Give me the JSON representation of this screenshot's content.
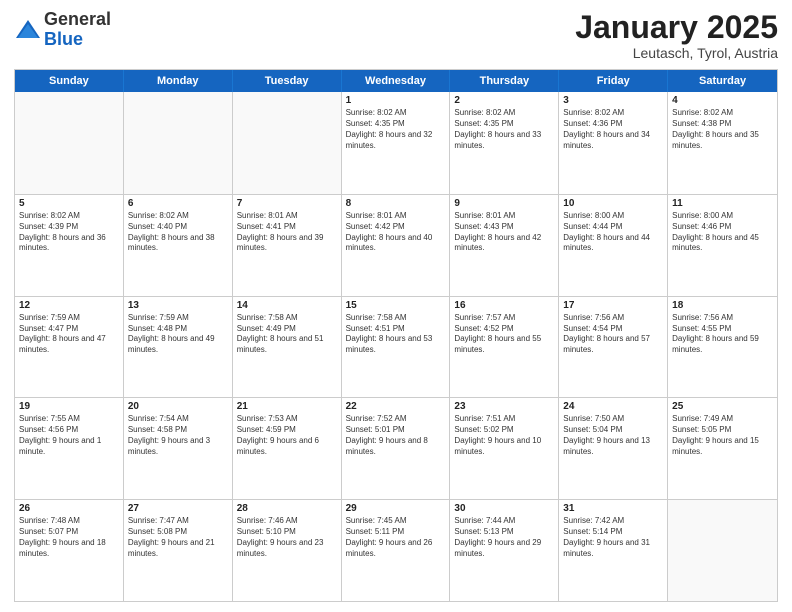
{
  "header": {
    "logo": {
      "general": "General",
      "blue": "Blue"
    },
    "title": "January 2025",
    "location": "Leutasch, Tyrol, Austria"
  },
  "days_of_week": [
    "Sunday",
    "Monday",
    "Tuesday",
    "Wednesday",
    "Thursday",
    "Friday",
    "Saturday"
  ],
  "weeks": [
    [
      {
        "day": "",
        "text": "",
        "empty": true
      },
      {
        "day": "",
        "text": "",
        "empty": true
      },
      {
        "day": "",
        "text": "",
        "empty": true
      },
      {
        "day": "1",
        "text": "Sunrise: 8:02 AM\nSunset: 4:35 PM\nDaylight: 8 hours and 32 minutes."
      },
      {
        "day": "2",
        "text": "Sunrise: 8:02 AM\nSunset: 4:35 PM\nDaylight: 8 hours and 33 minutes."
      },
      {
        "day": "3",
        "text": "Sunrise: 8:02 AM\nSunset: 4:36 PM\nDaylight: 8 hours and 34 minutes."
      },
      {
        "day": "4",
        "text": "Sunrise: 8:02 AM\nSunset: 4:38 PM\nDaylight: 8 hours and 35 minutes."
      }
    ],
    [
      {
        "day": "5",
        "text": "Sunrise: 8:02 AM\nSunset: 4:39 PM\nDaylight: 8 hours and 36 minutes."
      },
      {
        "day": "6",
        "text": "Sunrise: 8:02 AM\nSunset: 4:40 PM\nDaylight: 8 hours and 38 minutes."
      },
      {
        "day": "7",
        "text": "Sunrise: 8:01 AM\nSunset: 4:41 PM\nDaylight: 8 hours and 39 minutes."
      },
      {
        "day": "8",
        "text": "Sunrise: 8:01 AM\nSunset: 4:42 PM\nDaylight: 8 hours and 40 minutes."
      },
      {
        "day": "9",
        "text": "Sunrise: 8:01 AM\nSunset: 4:43 PM\nDaylight: 8 hours and 42 minutes."
      },
      {
        "day": "10",
        "text": "Sunrise: 8:00 AM\nSunset: 4:44 PM\nDaylight: 8 hours and 44 minutes."
      },
      {
        "day": "11",
        "text": "Sunrise: 8:00 AM\nSunset: 4:46 PM\nDaylight: 8 hours and 45 minutes."
      }
    ],
    [
      {
        "day": "12",
        "text": "Sunrise: 7:59 AM\nSunset: 4:47 PM\nDaylight: 8 hours and 47 minutes."
      },
      {
        "day": "13",
        "text": "Sunrise: 7:59 AM\nSunset: 4:48 PM\nDaylight: 8 hours and 49 minutes."
      },
      {
        "day": "14",
        "text": "Sunrise: 7:58 AM\nSunset: 4:49 PM\nDaylight: 8 hours and 51 minutes."
      },
      {
        "day": "15",
        "text": "Sunrise: 7:58 AM\nSunset: 4:51 PM\nDaylight: 8 hours and 53 minutes."
      },
      {
        "day": "16",
        "text": "Sunrise: 7:57 AM\nSunset: 4:52 PM\nDaylight: 8 hours and 55 minutes."
      },
      {
        "day": "17",
        "text": "Sunrise: 7:56 AM\nSunset: 4:54 PM\nDaylight: 8 hours and 57 minutes."
      },
      {
        "day": "18",
        "text": "Sunrise: 7:56 AM\nSunset: 4:55 PM\nDaylight: 8 hours and 59 minutes."
      }
    ],
    [
      {
        "day": "19",
        "text": "Sunrise: 7:55 AM\nSunset: 4:56 PM\nDaylight: 9 hours and 1 minute."
      },
      {
        "day": "20",
        "text": "Sunrise: 7:54 AM\nSunset: 4:58 PM\nDaylight: 9 hours and 3 minutes."
      },
      {
        "day": "21",
        "text": "Sunrise: 7:53 AM\nSunset: 4:59 PM\nDaylight: 9 hours and 6 minutes."
      },
      {
        "day": "22",
        "text": "Sunrise: 7:52 AM\nSunset: 5:01 PM\nDaylight: 9 hours and 8 minutes."
      },
      {
        "day": "23",
        "text": "Sunrise: 7:51 AM\nSunset: 5:02 PM\nDaylight: 9 hours and 10 minutes."
      },
      {
        "day": "24",
        "text": "Sunrise: 7:50 AM\nSunset: 5:04 PM\nDaylight: 9 hours and 13 minutes."
      },
      {
        "day": "25",
        "text": "Sunrise: 7:49 AM\nSunset: 5:05 PM\nDaylight: 9 hours and 15 minutes."
      }
    ],
    [
      {
        "day": "26",
        "text": "Sunrise: 7:48 AM\nSunset: 5:07 PM\nDaylight: 9 hours and 18 minutes."
      },
      {
        "day": "27",
        "text": "Sunrise: 7:47 AM\nSunset: 5:08 PM\nDaylight: 9 hours and 21 minutes."
      },
      {
        "day": "28",
        "text": "Sunrise: 7:46 AM\nSunset: 5:10 PM\nDaylight: 9 hours and 23 minutes."
      },
      {
        "day": "29",
        "text": "Sunrise: 7:45 AM\nSunset: 5:11 PM\nDaylight: 9 hours and 26 minutes."
      },
      {
        "day": "30",
        "text": "Sunrise: 7:44 AM\nSunset: 5:13 PM\nDaylight: 9 hours and 29 minutes."
      },
      {
        "day": "31",
        "text": "Sunrise: 7:42 AM\nSunset: 5:14 PM\nDaylight: 9 hours and 31 minutes."
      },
      {
        "day": "",
        "text": "",
        "empty": true
      }
    ]
  ]
}
